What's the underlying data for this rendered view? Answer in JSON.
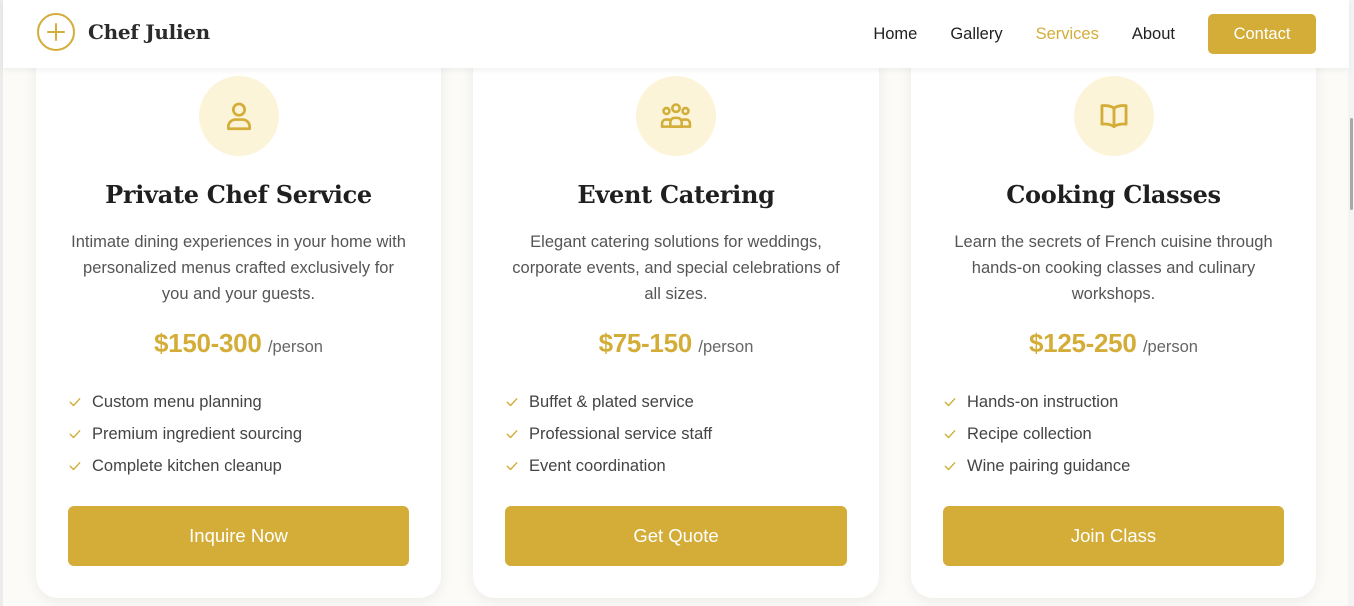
{
  "brand": {
    "name": "Chef Julien",
    "logo_icon": "plus-in-circle-icon",
    "accent_color": "#d3ad38"
  },
  "nav": {
    "items": [
      {
        "label": "Home",
        "active": false
      },
      {
        "label": "Gallery",
        "active": false
      },
      {
        "label": "Services",
        "active": true
      },
      {
        "label": "About",
        "active": false
      }
    ],
    "contact_label": "Contact"
  },
  "services": [
    {
      "icon": "user-icon",
      "title": "Private Chef Service",
      "description": "Intimate dining experiences in your home with personalized menus crafted exclusively for you and your guests.",
      "price": "$150-300",
      "unit": "/person",
      "features": [
        "Custom menu planning",
        "Premium ingredient sourcing",
        "Complete kitchen cleanup"
      ],
      "cta": "Inquire Now"
    },
    {
      "icon": "users-group-icon",
      "title": "Event Catering",
      "description": "Elegant catering solutions for weddings, corporate events, and special celebrations of all sizes.",
      "price": "$75-150",
      "unit": "/person",
      "features": [
        "Buffet & plated service",
        "Professional service staff",
        "Event coordination"
      ],
      "cta": "Get Quote"
    },
    {
      "icon": "open-book-icon",
      "title": "Cooking Classes",
      "description": "Learn the secrets of French cuisine through hands-on cooking classes and culinary workshops.",
      "price": "$125-250",
      "unit": "/person",
      "features": [
        "Hands-on instruction",
        "Recipe collection",
        "Wine pairing guidance"
      ],
      "cta": "Join Class"
    }
  ]
}
